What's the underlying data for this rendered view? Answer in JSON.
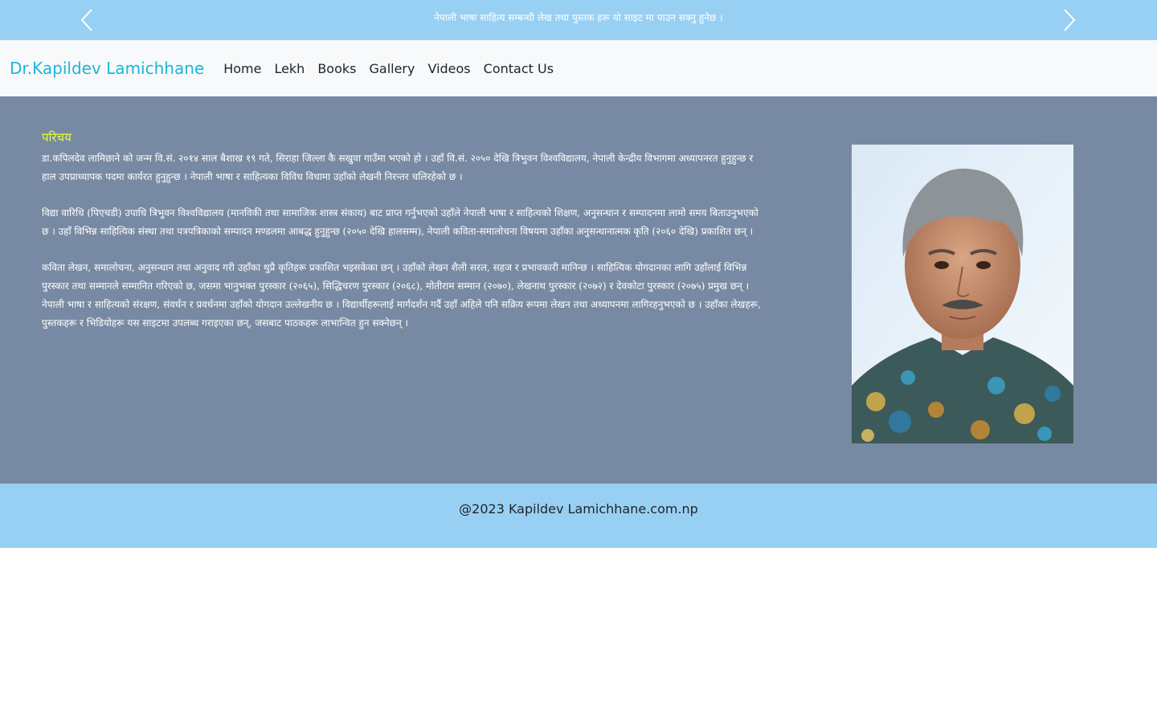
{
  "announcement": {
    "text": "नेपाली भाषा साहित्य सम्बन्धी लेख तथा पुस्तक हरू यो साइट मा पाउन सक्नु हुनेछ ।"
  },
  "navbar": {
    "brand": "Dr.Kapildev Lamichhane",
    "links": [
      "Home",
      "Lekh",
      "Books",
      "Gallery",
      "Videos",
      "Contact Us"
    ]
  },
  "content": {
    "heading": "परिचय",
    "paragraphs": [
      "डा.कपिलदेव लामिछाने को जन्म वि.सं. २०१४ साल बैशाख १९ गते, सिराहा जिल्ला कै सखुवा गाउँमा भएको हो । उहाँ वि.सं. २०५० देखि त्रिभुवन विश्वविद्यालय, नेपाली केन्द्रीय विभागमा अध्यापनरत हुनुहुन्छ र हाल उपप्राध्यापक पदमा कार्यरत हुनुहुन्छ । नेपाली भाषा र साहित्यका विविध विधामा उहाँको लेखनी निरन्तर चलिरहेको छ ।",
      "विद्या वारिधि (पिएचडी) उपाधि त्रिभुवन विश्वविद्यालय (मानविकी तथा सामाजिक शास्त्र संकाय) बाट प्राप्त गर्नुभएको उहाँले नेपाली भाषा र साहित्यको शिक्षण, अनुसन्धान र सम्पादनमा लामो समय बिताउनुभएको छ । उहाँ विभिन्न साहित्यिक संस्था तथा पत्रपत्रिकाको सम्पादन मण्डलमा आबद्ध हुनुहुन्छ (२०५० देखि हालसम्म), नेपाली कविता-समालोचना विषयमा उहाँका अनुसन्धानात्मक कृति (२०६० देखि) प्रकाशित छन् ।",
      "कविता लेखन, समालोचना, अनुसन्धान तथा अनुवाद गरी उहाँका थुप्रै कृतिहरू प्रकाशित भइसकेका छन् । उहाँको लेखन शैली सरल, सहज र प्रभावकारी मानिन्छ । साहित्यिक योगदानका लागि उहाँलाई विभिन्न पुरस्कार तथा सम्मानले सम्मानित गरिएको छ, जसमा भानुभक्त पुरस्कार (२०६५), सिद्धिचरण पुरस्कार (२०६८), मोतीराम सम्मान (२०७०), लेखनाथ पुरस्कार (२०७२) र देवकोटा पुरस्कार (२०७५) प्रमुख छन् । नेपाली भाषा र साहित्यको संरक्षण, संवर्धन र प्रवर्धनमा उहाँको योगदान उल्लेखनीय छ । विद्यार्थीहरूलाई मार्गदर्शन गर्दै उहाँ अहिले पनि सक्रिय रूपमा लेखन तथा अध्यापनमा लागिरहनुभएको छ । उहाँका लेखहरू, पुस्तकहरू र भिडियोहरू यस साइटमा उपलब्ध गराइएका छन्, जसबाट पाठकहरू लाभान्वित हुन सक्नेछन् ।"
    ]
  },
  "footer": {
    "copyright": "@2023 Kapildev Lamichhane.com.np"
  },
  "colors": {
    "topbar_bg": "#98d0f3",
    "navbar_bg": "#f8f9fa",
    "brand": "#1ab6dd",
    "main_bg": "#788aa3",
    "heading": "#e9ff3b",
    "footer_bg": "#98d0f3"
  },
  "icons": {
    "prev": "chevron-left-icon",
    "next": "chevron-right-icon"
  }
}
